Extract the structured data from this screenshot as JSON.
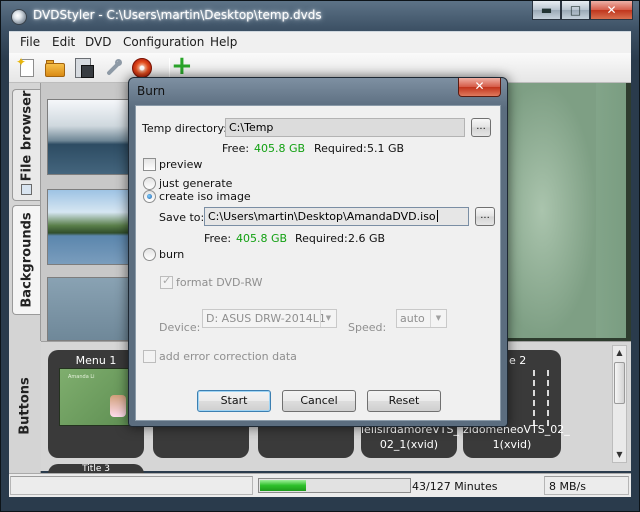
{
  "window": {
    "title": "DVDStyler - C:\\Users\\martin\\Desktop\\temp.dvds",
    "minimize": "▬",
    "maximize": "□",
    "close": "✕"
  },
  "menubar": {
    "items": [
      "File",
      "Edit",
      "DVD",
      "Configuration",
      "Help"
    ]
  },
  "toolbar": {
    "icons": [
      "new-project-icon",
      "open-folder-icon",
      "save-icon",
      "settings-wrench-icon",
      "burn-disc-icon",
      "add-file-icon"
    ]
  },
  "side_tabs": {
    "file_browser": "File browser",
    "backgrounds": "Backgrounds",
    "buttons": "Buttons"
  },
  "titleset": {
    "menu1_label": "Menu 1",
    "menu1_preview_text": "Amanda Li",
    "box_d_text_line1": "lelisirdamoreVTS_",
    "box_d_text_line2": "02_1(xvid)",
    "box_e_header": "e 2",
    "box_e_text_line1": "zidomeneoVTS_02_",
    "box_e_text_line2": "1(xvid)",
    "title3_label": "Title 3"
  },
  "statusbar": {
    "progress_fraction": 0.31,
    "duration": "43/127 Minutes",
    "bitrate": "8 MB/s"
  },
  "dialog": {
    "title": "Burn",
    "close": "✕",
    "temp_directory_label": "Temp directory:",
    "temp_directory_value": "C:\\Temp",
    "temp_browse": "...",
    "temp_free_label": "Free:",
    "temp_free_value": "405.8 GB",
    "temp_required_label": "Required:",
    "temp_required_value": "5.1 GB",
    "preview_label": "preview",
    "preview_checked": false,
    "just_generate_label": "just generate",
    "create_iso_label": "create iso image",
    "selected_mode": "create iso image",
    "save_to_label": "Save to:",
    "save_to_value": "C:\\Users\\martin\\Desktop\\AmandaDVD.iso",
    "save_browse": "...",
    "iso_free_label": "Free:",
    "iso_free_value": "405.8 GB",
    "iso_required_label": "Required:",
    "iso_required_value": "2.6 GB",
    "burn_label": "burn",
    "format_label": "format DVD-RW",
    "format_checked": true,
    "device_label": "Device:",
    "device_value": "D: ASUS DRW-2014L1",
    "speed_label": "Speed:",
    "speed_value": "auto",
    "error_correction_label": "add error correction data",
    "start_button": "Start",
    "cancel_button": "Cancel",
    "reset_button": "Reset",
    "accent_green": "#12a012"
  }
}
